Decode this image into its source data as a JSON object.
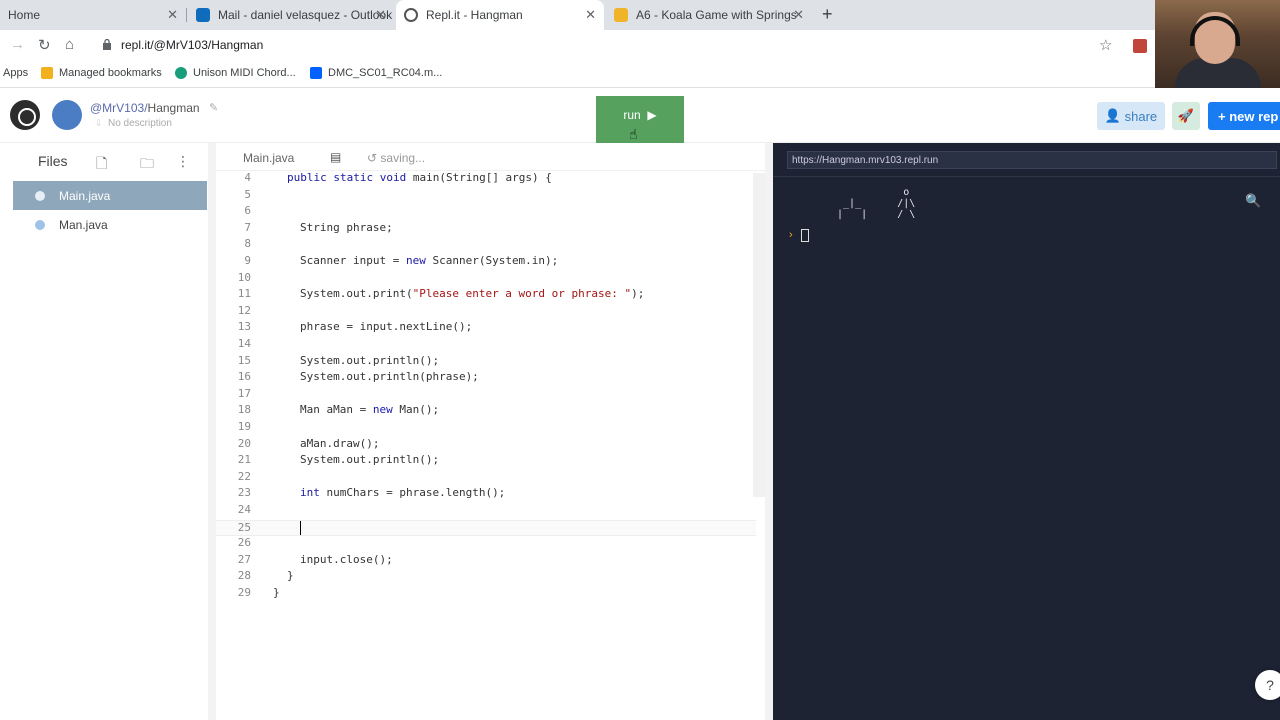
{
  "browser": {
    "tabs": [
      {
        "label": "Home"
      },
      {
        "label": "Mail - daniel velasquez - Outlook"
      },
      {
        "label": "Repl.it - Hangman"
      },
      {
        "label": "A6 - Koala Game with Springs"
      }
    ],
    "url": "repl.it/@MrV103/Hangman",
    "bookmarks": [
      {
        "label": "Apps"
      },
      {
        "label": "Managed bookmarks"
      },
      {
        "label": "Unison MIDI Chord..."
      },
      {
        "label": "DMC_SC01_RC04.m..."
      }
    ]
  },
  "repl": {
    "owner": "@MrV103/",
    "name": "Hangman",
    "description": "No description",
    "run_label": "run",
    "share_label": "share",
    "new_repl_label": "new rep"
  },
  "files": {
    "title": "Files",
    "items": [
      {
        "name": "Main.java",
        "active": true
      },
      {
        "name": "Man.java",
        "active": false
      }
    ]
  },
  "editor": {
    "tab_name": "Main.java",
    "status": "saving...",
    "lines": [
      {
        "n": "4",
        "indent": 1,
        "segs": [
          [
            "kw",
            "public static void "
          ],
          [
            "",
            "main(String[] args) {"
          ]
        ]
      },
      {
        "n": "5",
        "indent": 0,
        "segs": []
      },
      {
        "n": "6",
        "indent": 0,
        "segs": []
      },
      {
        "n": "7",
        "indent": 2,
        "segs": [
          [
            "",
            "String phrase;"
          ]
        ]
      },
      {
        "n": "8",
        "indent": 0,
        "segs": []
      },
      {
        "n": "9",
        "indent": 2,
        "segs": [
          [
            "",
            "Scanner input = "
          ],
          [
            "kw",
            "new "
          ],
          [
            "",
            "Scanner(System.in);"
          ]
        ]
      },
      {
        "n": "10",
        "indent": 0,
        "segs": []
      },
      {
        "n": "11",
        "indent": 2,
        "segs": [
          [
            "",
            "System.out.print("
          ],
          [
            "str",
            "\"Please enter a word or phrase: \""
          ],
          [
            "",
            ");"
          ]
        ]
      },
      {
        "n": "12",
        "indent": 0,
        "segs": []
      },
      {
        "n": "13",
        "indent": 2,
        "segs": [
          [
            "",
            "phrase = input.nextLine();"
          ]
        ]
      },
      {
        "n": "14",
        "indent": 0,
        "segs": []
      },
      {
        "n": "15",
        "indent": 2,
        "segs": [
          [
            "",
            "System.out.println();"
          ]
        ]
      },
      {
        "n": "16",
        "indent": 2,
        "segs": [
          [
            "",
            "System.out.println(phrase);"
          ]
        ]
      },
      {
        "n": "17",
        "indent": 0,
        "segs": []
      },
      {
        "n": "18",
        "indent": 2,
        "segs": [
          [
            "",
            "Man aMan = "
          ],
          [
            "kw",
            "new "
          ],
          [
            "",
            "Man();"
          ]
        ]
      },
      {
        "n": "19",
        "indent": 0,
        "segs": []
      },
      {
        "n": "20",
        "indent": 2,
        "segs": [
          [
            "",
            "aMan.draw();"
          ]
        ]
      },
      {
        "n": "21",
        "indent": 2,
        "segs": [
          [
            "",
            "System.out.println();"
          ]
        ]
      },
      {
        "n": "22",
        "indent": 0,
        "segs": []
      },
      {
        "n": "23",
        "indent": 2,
        "segs": [
          [
            "kw",
            "int "
          ],
          [
            "",
            "numChars = phrase.length();"
          ]
        ]
      },
      {
        "n": "24",
        "indent": 0,
        "segs": []
      },
      {
        "n": "25",
        "indent": 2,
        "segs": [],
        "current": true
      },
      {
        "n": "26",
        "indent": 0,
        "segs": []
      },
      {
        "n": "27",
        "indent": 2,
        "segs": [
          [
            "",
            "input.close();"
          ]
        ]
      },
      {
        "n": "28",
        "indent": 1,
        "segs": [
          [
            "",
            "}"
          ]
        ]
      },
      {
        "n": "29",
        "indent": 0,
        "segs": [
          [
            "",
            "}"
          ]
        ]
      }
    ]
  },
  "console": {
    "url": "https://Hangman.mrv103.repl.run",
    "ascii_art": "            o\n  _|_      /|\\\n |   |     / \\",
    "prompt": "›"
  },
  "colors": {
    "run_green": "#56a15d",
    "new_repl_blue": "#1a7cf3",
    "console_bg": "#1d2333",
    "active_file_bg": "#8fa7bb"
  }
}
